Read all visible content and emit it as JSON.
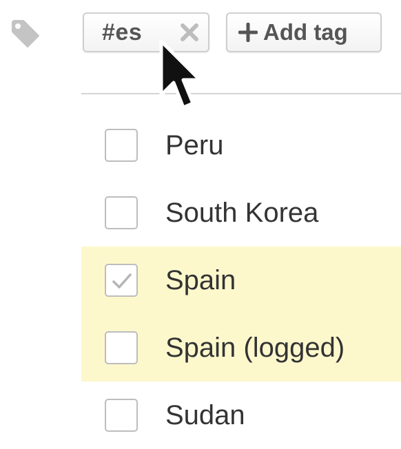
{
  "tags": {
    "chip_label": "#es",
    "add_tag_label": "Add tag"
  },
  "countries": [
    {
      "name": "Peru",
      "checked": false,
      "highlighted": false
    },
    {
      "name": "South Korea",
      "checked": false,
      "highlighted": false
    },
    {
      "name": "Spain",
      "checked": true,
      "highlighted": true
    },
    {
      "name": "Spain (logged)",
      "checked": false,
      "highlighted": true
    },
    {
      "name": "Sudan",
      "checked": false,
      "highlighted": false
    }
  ],
  "icons": {
    "tag": "tag-icon",
    "remove": "close-icon",
    "add": "plus-icon",
    "check": "check-icon",
    "cursor": "mouse-cursor-icon"
  },
  "colors": {
    "highlight": "#fdf8cc",
    "border": "#cfcfcf",
    "text": "#333333",
    "icon_gray": "#c4c4c4"
  }
}
